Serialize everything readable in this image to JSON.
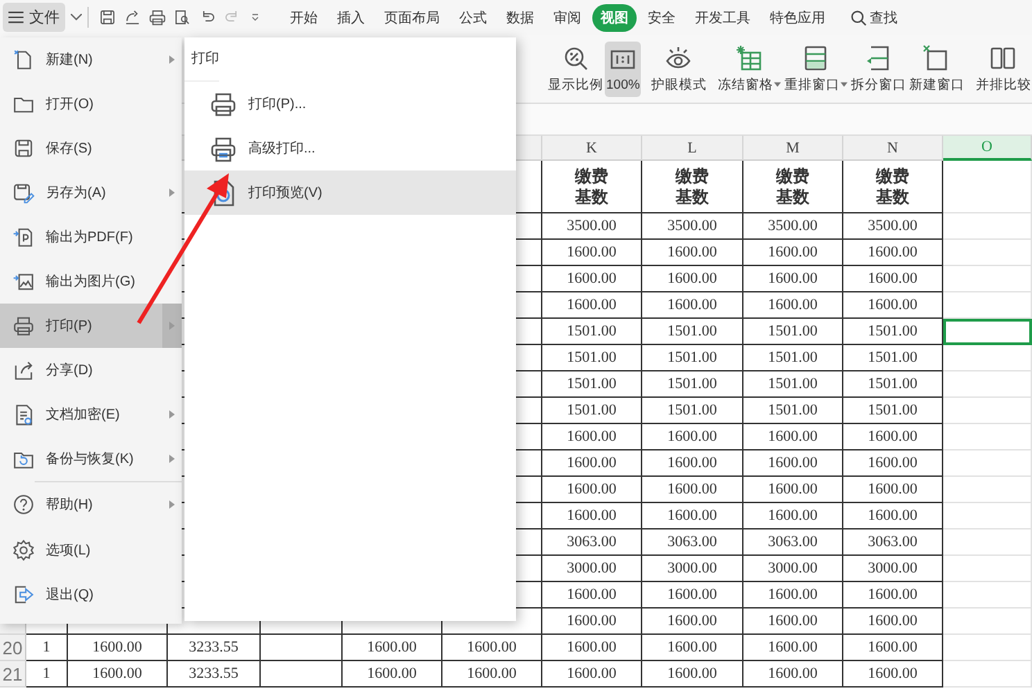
{
  "toolbar": {
    "file_button": "文件",
    "tabs": [
      {
        "label": "开始",
        "selected": false
      },
      {
        "label": "插入",
        "selected": false
      },
      {
        "label": "页面布局",
        "selected": false
      },
      {
        "label": "公式",
        "selected": false
      },
      {
        "label": "数据",
        "selected": false
      },
      {
        "label": "审阅",
        "selected": false
      },
      {
        "label": "视图",
        "selected": true
      },
      {
        "label": "安全",
        "selected": false
      },
      {
        "label": "开发工具",
        "selected": false
      },
      {
        "label": "特色应用",
        "selected": false
      }
    ],
    "search": "查找"
  },
  "ribbon": [
    {
      "label": "显示比例",
      "selected": false,
      "dropdown": false
    },
    {
      "label": "100%",
      "selected": true,
      "dropdown": false
    },
    {
      "label": "护眼模式",
      "selected": false,
      "dropdown": false
    },
    {
      "label": "冻结窗格",
      "selected": false,
      "dropdown": true
    },
    {
      "label": "重排窗口",
      "selected": false,
      "dropdown": true
    },
    {
      "label": "拆分窗口",
      "selected": false,
      "dropdown": false
    },
    {
      "label": "新建窗口",
      "selected": false,
      "dropdown": false
    },
    {
      "label": "并排比较",
      "selected": false,
      "dropdown": false
    }
  ],
  "file_menu": [
    {
      "label": "新建(N)",
      "selected": false,
      "submenu": true,
      "divider_before": false
    },
    {
      "label": "打开(O)",
      "selected": false,
      "submenu": false,
      "divider_before": false
    },
    {
      "label": "保存(S)",
      "selected": false,
      "submenu": false,
      "divider_before": false
    },
    {
      "label": "另存为(A)",
      "selected": false,
      "submenu": true,
      "divider_before": false
    },
    {
      "label": "输出为PDF(F)",
      "selected": false,
      "submenu": false,
      "divider_before": false
    },
    {
      "label": "输出为图片(G)",
      "selected": false,
      "submenu": false,
      "divider_before": false
    },
    {
      "label": "打印(P)",
      "selected": true,
      "submenu": true,
      "divider_before": false
    },
    {
      "label": "分享(D)",
      "selected": false,
      "submenu": false,
      "divider_before": false
    },
    {
      "label": "文档加密(E)",
      "selected": false,
      "submenu": true,
      "divider_before": false
    },
    {
      "label": "备份与恢复(K)",
      "selected": false,
      "submenu": true,
      "divider_before": false
    },
    {
      "label": "帮助(H)",
      "selected": false,
      "submenu": true,
      "divider_before": true
    },
    {
      "label": "选项(L)",
      "selected": false,
      "submenu": false,
      "divider_before": false
    },
    {
      "label": "退出(Q)",
      "selected": false,
      "submenu": false,
      "divider_before": false
    }
  ],
  "print_menu": {
    "title": "打印",
    "items": [
      {
        "label": "打印(P)...",
        "selected": false
      },
      {
        "label": "高级打印...",
        "selected": false
      },
      {
        "label": "打印预览(V)",
        "selected": true
      }
    ]
  },
  "sheet": {
    "columns": [
      {
        "label": "K",
        "selected": false
      },
      {
        "label": "L",
        "selected": false
      },
      {
        "label": "M",
        "selected": false
      },
      {
        "label": "N",
        "selected": false
      },
      {
        "label": "O",
        "selected": true
      }
    ],
    "header_cells": [
      [
        "缴费",
        "基数"
      ],
      [
        "缴费",
        "基数"
      ],
      [
        "缴费",
        "基数"
      ],
      [
        "缴费",
        "基数"
      ]
    ],
    "rows": [
      {
        "values": [
          "3500.00",
          "3500.00",
          "3500.00",
          "3500.00"
        ],
        "o_selected": false
      },
      {
        "values": [
          "1600.00",
          "1600.00",
          "1600.00",
          "1600.00"
        ],
        "o_selected": false
      },
      {
        "values": [
          "1600.00",
          "1600.00",
          "1600.00",
          "1600.00"
        ],
        "o_selected": false
      },
      {
        "values": [
          "1600.00",
          "1600.00",
          "1600.00",
          "1600.00"
        ],
        "o_selected": false
      },
      {
        "values": [
          "1501.00",
          "1501.00",
          "1501.00",
          "1501.00"
        ],
        "o_selected": true
      },
      {
        "values": [
          "1501.00",
          "1501.00",
          "1501.00",
          "1501.00"
        ],
        "o_selected": false
      },
      {
        "values": [
          "1501.00",
          "1501.00",
          "1501.00",
          "1501.00"
        ],
        "o_selected": false
      },
      {
        "values": [
          "1501.00",
          "1501.00",
          "1501.00",
          "1501.00"
        ],
        "o_selected": false
      },
      {
        "values": [
          "1600.00",
          "1600.00",
          "1600.00",
          "1600.00"
        ],
        "o_selected": false
      },
      {
        "values": [
          "1600.00",
          "1600.00",
          "1600.00",
          "1600.00"
        ],
        "o_selected": false
      },
      {
        "values": [
          "1600.00",
          "1600.00",
          "1600.00",
          "1600.00"
        ],
        "o_selected": false
      },
      {
        "values": [
          "1600.00",
          "1600.00",
          "1600.00",
          "1600.00"
        ],
        "o_selected": false
      },
      {
        "values": [
          "3063.00",
          "3063.00",
          "3063.00",
          "3063.00"
        ],
        "o_selected": false
      },
      {
        "values": [
          "3000.00",
          "3000.00",
          "3000.00",
          "3000.00"
        ],
        "o_selected": false
      },
      {
        "values": [
          "1600.00",
          "1600.00",
          "1600.00",
          "1600.00"
        ],
        "o_selected": false
      },
      {
        "values": [
          "1600.00",
          "1600.00",
          "1600.00",
          "1600.00"
        ],
        "o_selected": false
      },
      {
        "number": "20",
        "left": {
          "a": "1",
          "b": "1600.00",
          "c": "3233.55",
          "e": "1600.00",
          "f": "1600.00"
        },
        "values": [
          "1600.00",
          "1600.00",
          "1600.00",
          "1600.00"
        ],
        "o_selected": false
      },
      {
        "number": "21",
        "left": {
          "a": "1",
          "b": "1600.00",
          "c": "3233.55",
          "e": "1600.00",
          "f": "1600.00"
        },
        "values": [
          "1600.00",
          "1600.00",
          "1600.00",
          "1600.00"
        ],
        "o_selected": false
      }
    ]
  }
}
